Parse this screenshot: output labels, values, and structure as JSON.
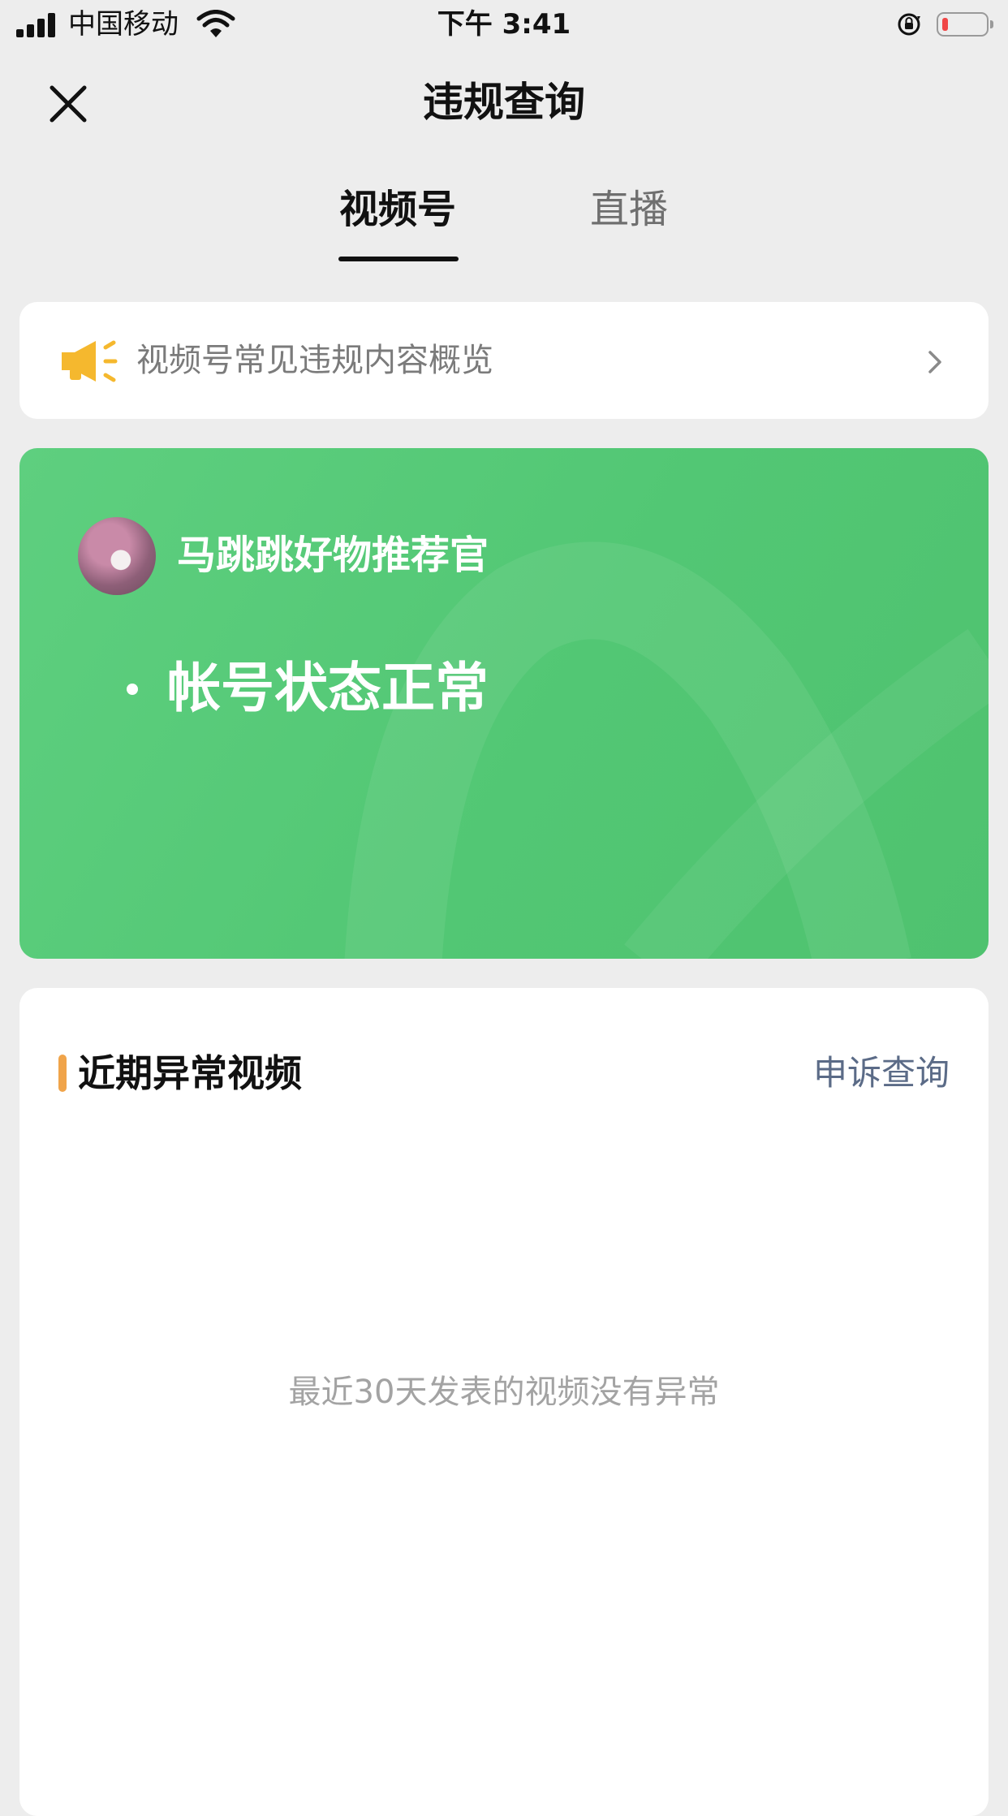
{
  "status_bar": {
    "carrier": "中国移动",
    "time": "下午 3:41",
    "icons": [
      "signal-icon",
      "wifi-icon",
      "orientation-lock-icon",
      "battery-icon"
    ],
    "battery_color": "#f04646"
  },
  "nav": {
    "title": "违规查询",
    "close_icon": "close-icon"
  },
  "tabs": [
    {
      "label": "视频号",
      "active": true
    },
    {
      "label": "直播",
      "active": false
    }
  ],
  "notice": {
    "icon": "megaphone-icon",
    "text": "视频号常见违规内容概览",
    "chevron": "chevron-right-icon",
    "icon_color": "#f5b82e"
  },
  "account_status": {
    "account_name": "马跳跳好物推荐官",
    "status": "帐号状态正常",
    "card_color": "#55c878"
  },
  "recent_abnormal": {
    "title": "近期异常视频",
    "appeal_link": "申诉查询",
    "empty_text": "最近30天发表的视频没有异常",
    "accent_color": "#f0a44a"
  }
}
